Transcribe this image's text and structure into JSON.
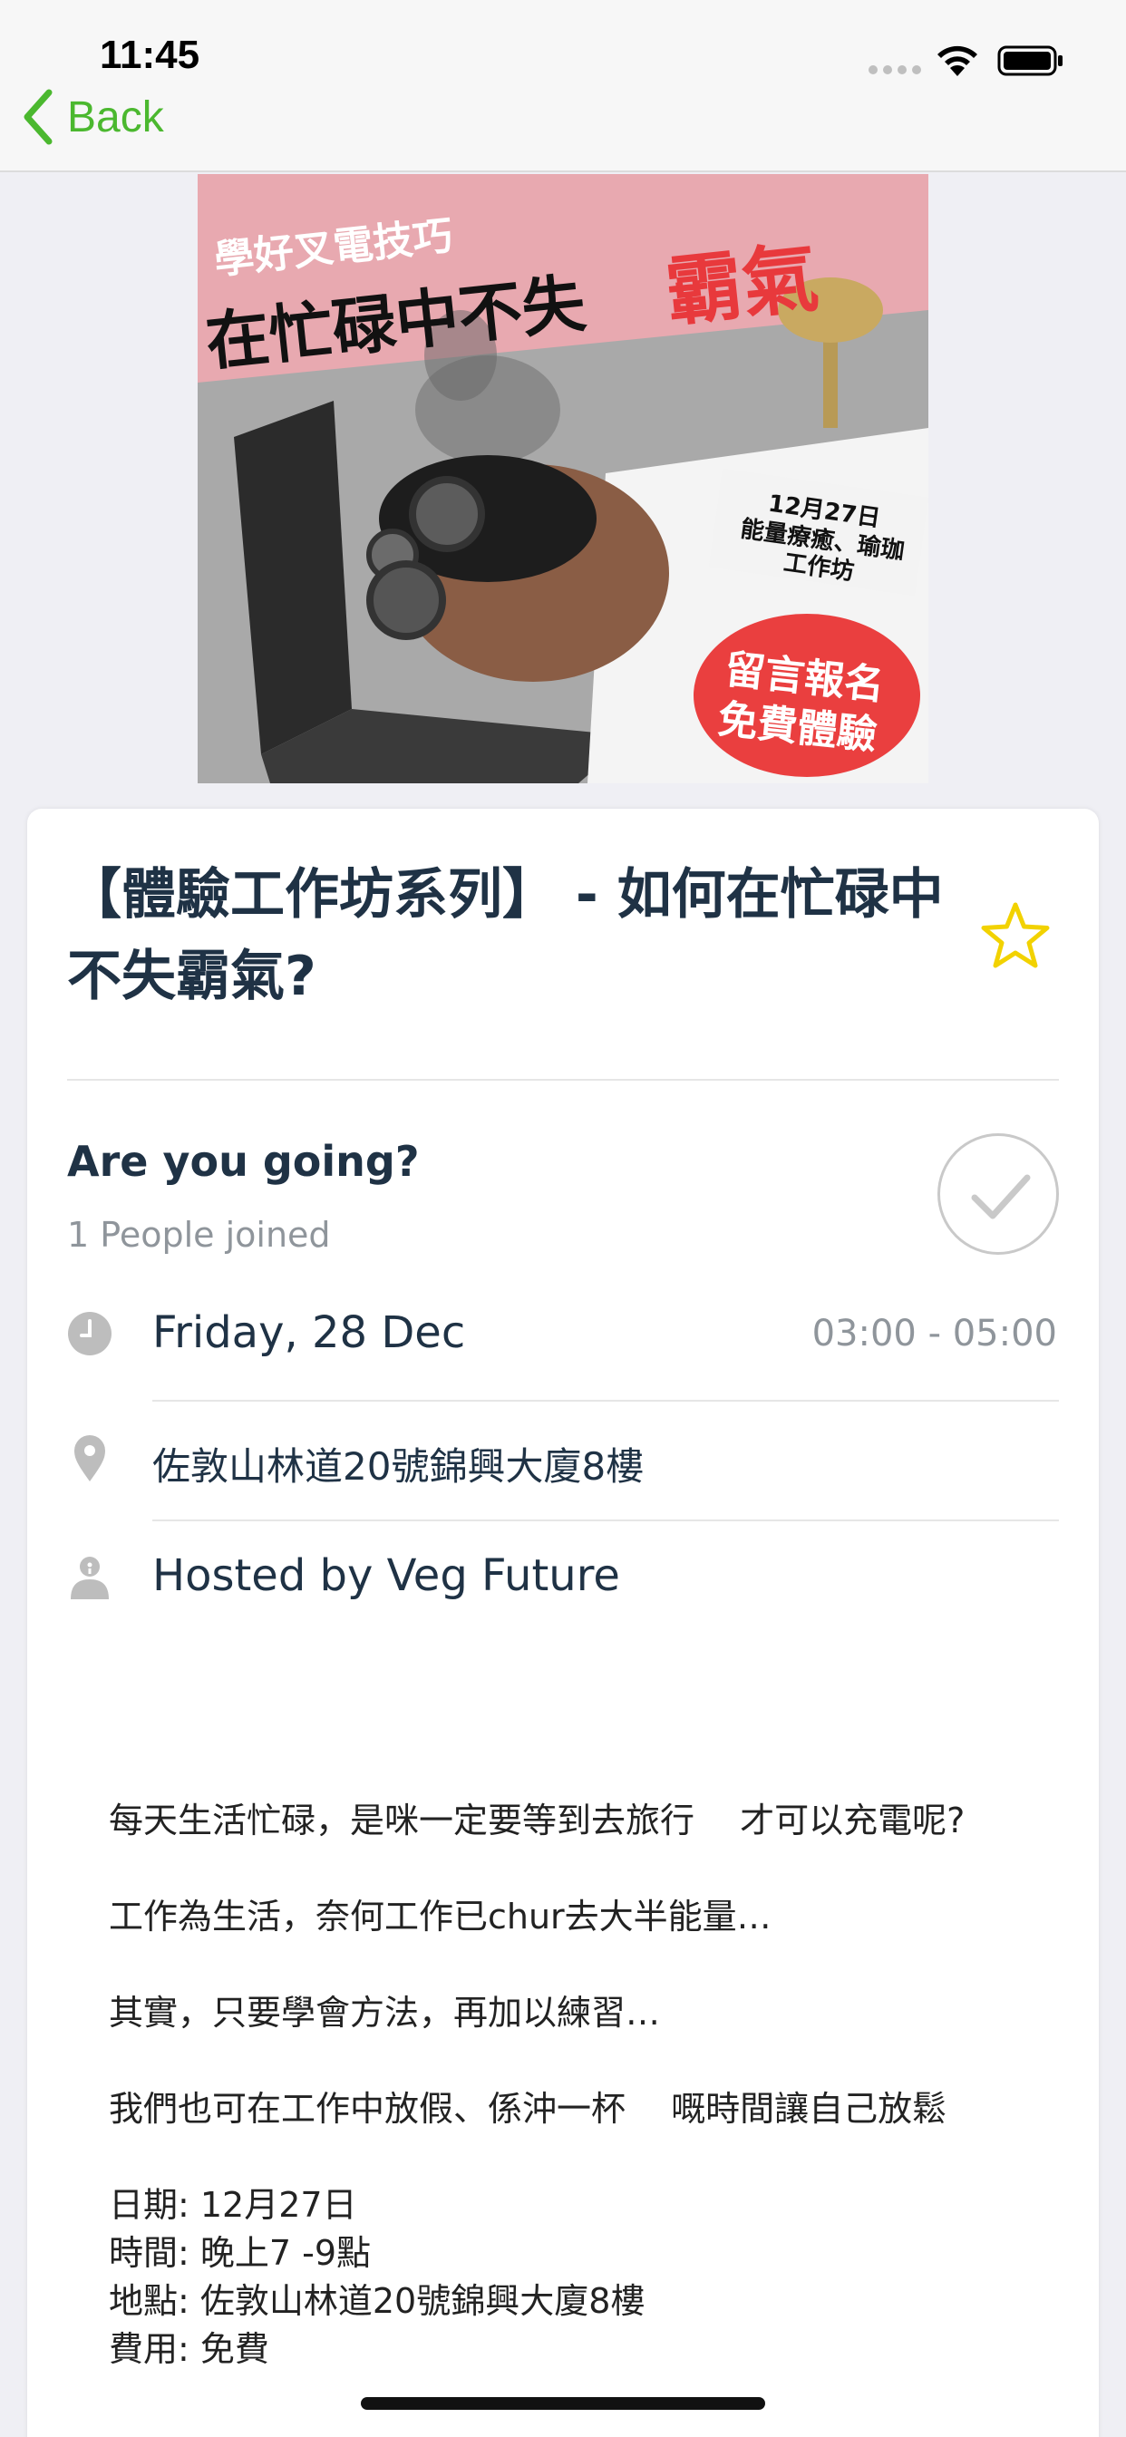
{
  "status_bar": {
    "time": "11:45"
  },
  "nav": {
    "back_label": "Back"
  },
  "poster": {
    "line1": "學好叉電技巧",
    "line2": "在忙碌中不失",
    "line2_accent": "霸氣",
    "badge": [
      "12月27日",
      "能量療癒、瑜珈",
      "工作坊"
    ],
    "cta": [
      "留言報名",
      "免費體驗"
    ]
  },
  "event": {
    "title": "【體驗工作坊系列】 - 如何在忙碌中不失霸氣?",
    "going_question": "Are you going?",
    "joined_text": "1 People joined",
    "date": "Friday, 28 Dec",
    "time_range": "03:00 - 05:00",
    "address": "佐敦山林道20號錦興大廈8樓",
    "host": "Hosted by Veg Future"
  },
  "description": [
    "每天生活忙碌，是咪一定要等到去旅行　 才可以充電呢?",
    "",
    "工作為生活，奈何工作已chur去大半能量…",
    "",
    "其實，只要學會方法，再加以練習…",
    "",
    "我們也可在工作中放假、係沖一杯　 嘅時間讓自己放鬆",
    "",
    "日期: 12月27日",
    "時間: 晚上7 -9點",
    "地點: 佐敦山林道20號錦興大廈8樓",
    "費用: 免費"
  ],
  "colors": {
    "accent": "#4bb82f",
    "star": "#f2d200",
    "text": "#1f3245",
    "muted": "#8f959b"
  },
  "icons": [
    "chevron-left-icon",
    "wifi-icon",
    "battery-icon",
    "star-icon",
    "checkmark-icon",
    "clock-icon",
    "location-pin-icon",
    "host-person-icon"
  ]
}
